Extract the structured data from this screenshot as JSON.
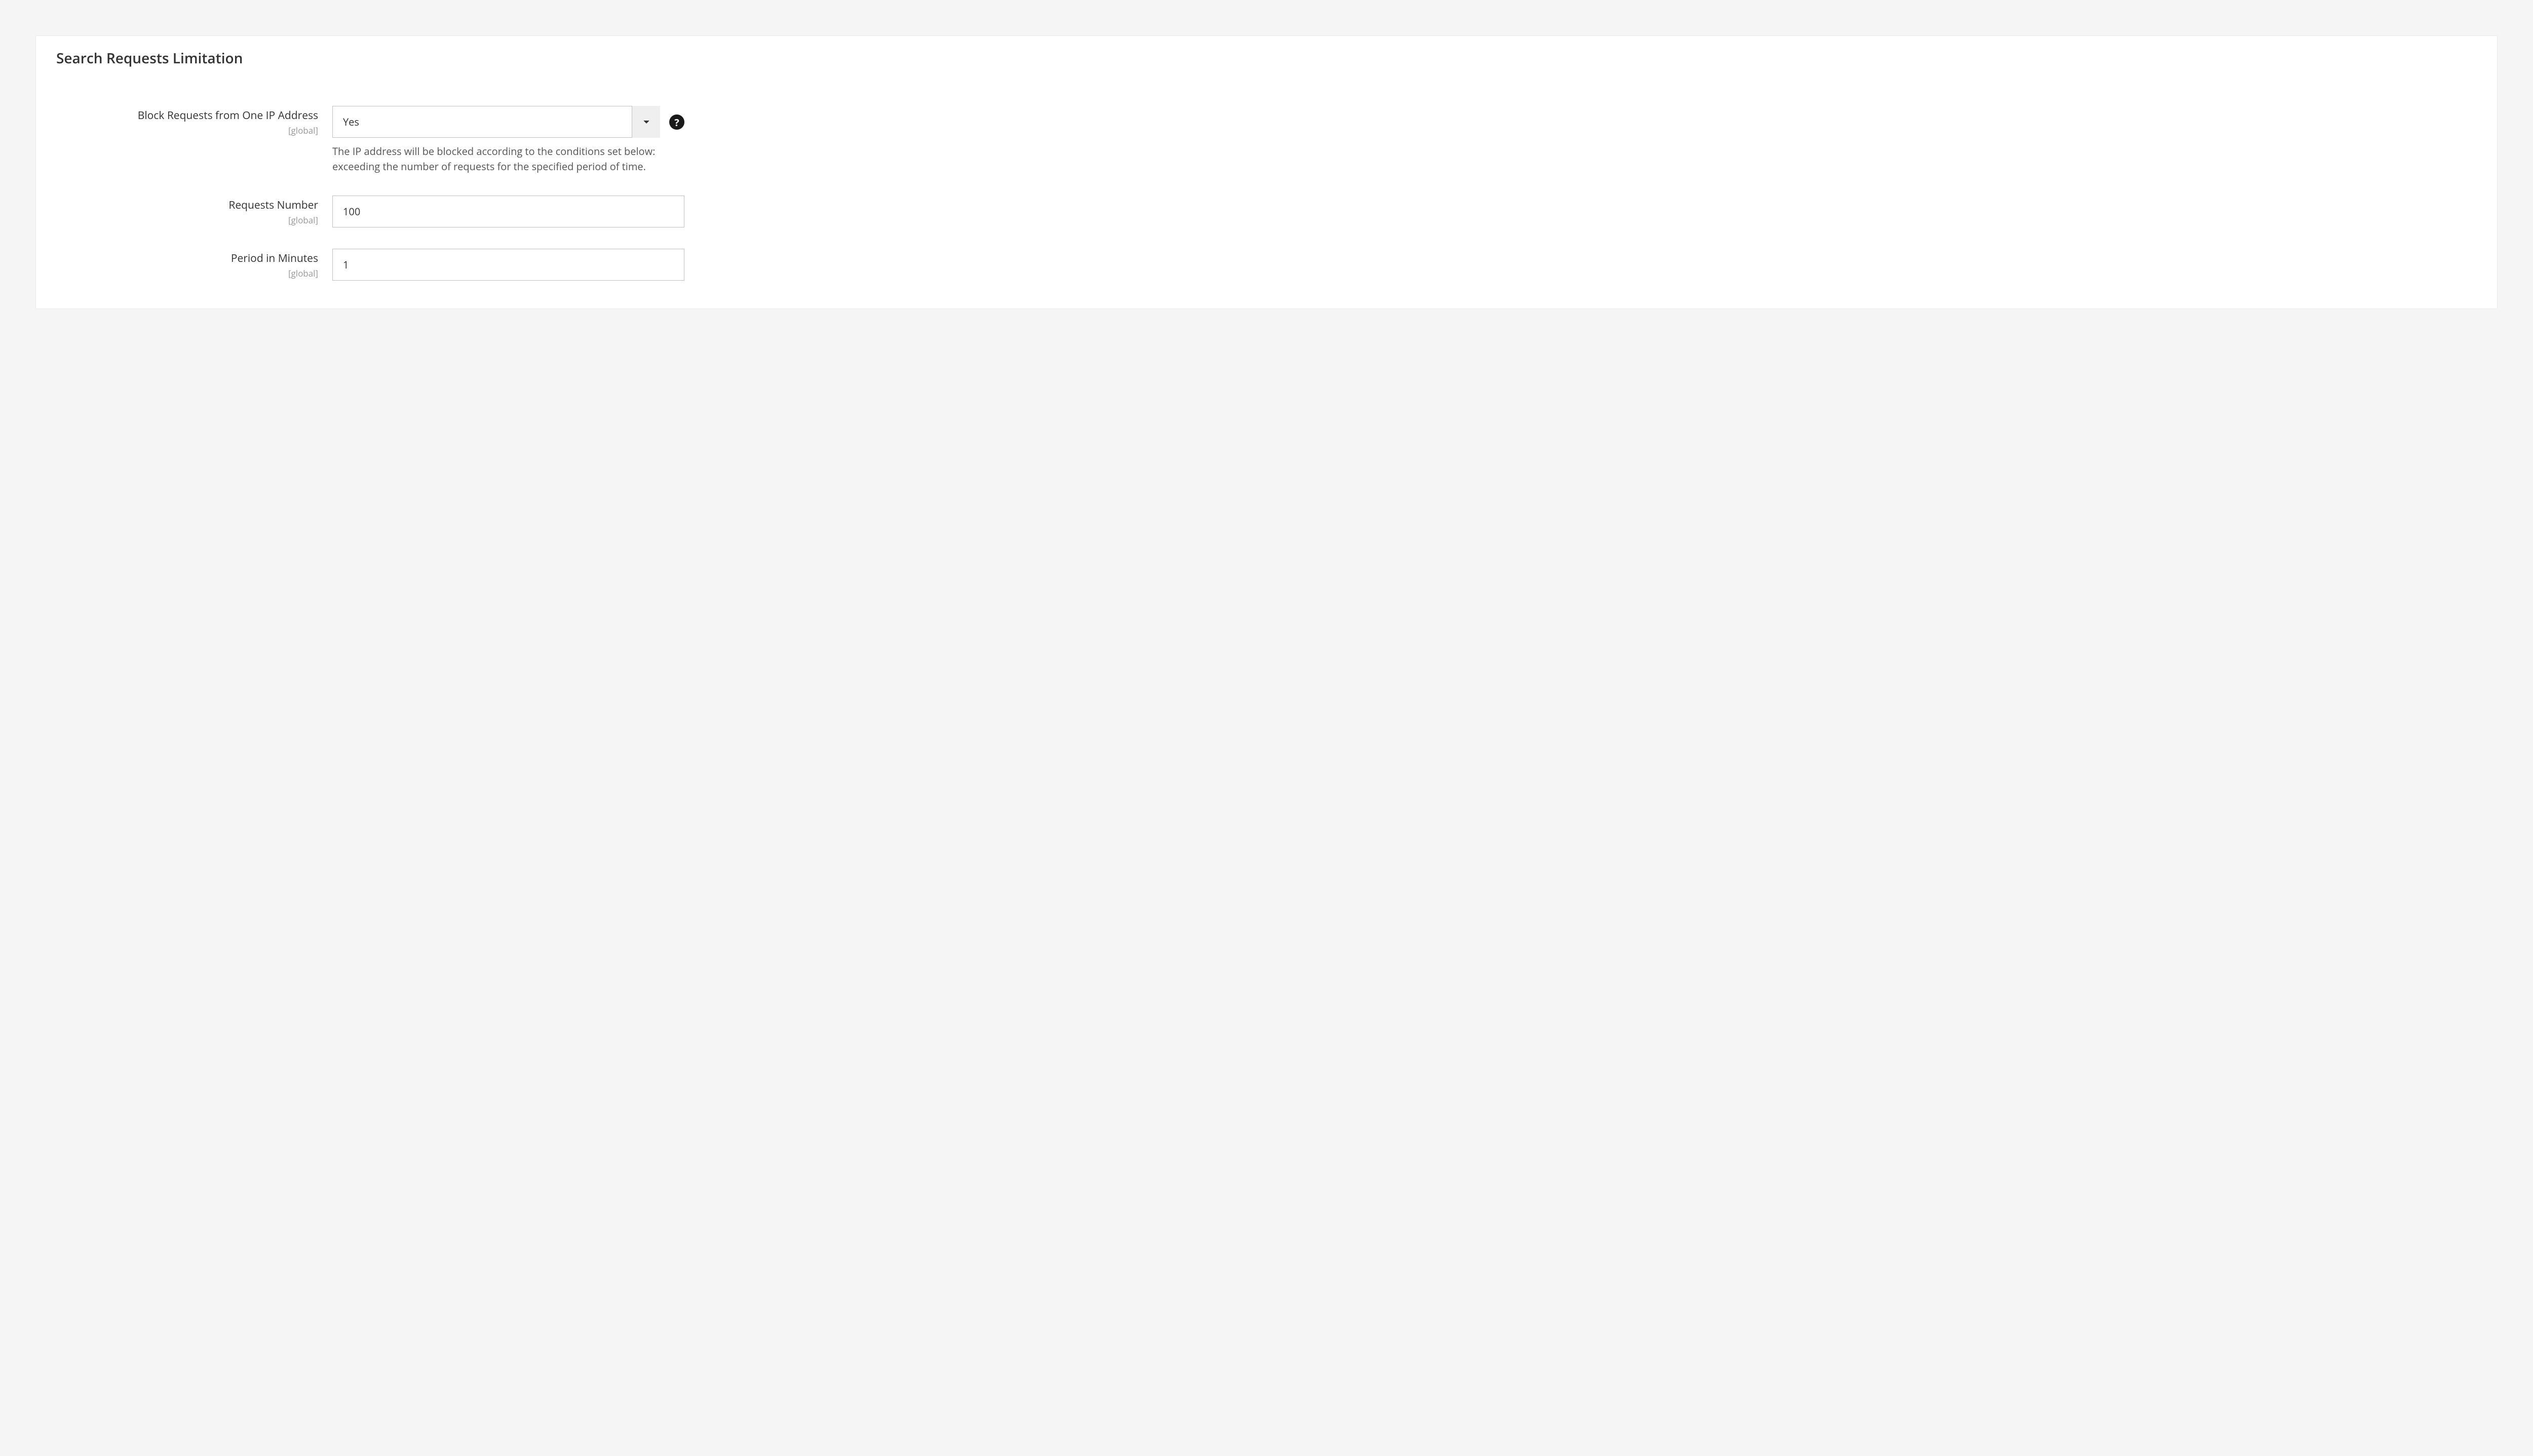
{
  "panel": {
    "title": "Search Requests Limitation"
  },
  "fields": {
    "block_requests": {
      "label": "Block Requests from One IP Address",
      "scope": "[global]",
      "value": "Yes",
      "hint": "The IP address will be blocked according to the conditions set below: exceeding the number of requests for the specified period of time."
    },
    "requests_number": {
      "label": "Requests Number",
      "scope": "[global]",
      "value": "100"
    },
    "period_minutes": {
      "label": "Period in Minutes",
      "scope": "[global]",
      "value": "1"
    }
  },
  "help_glyph": "?"
}
